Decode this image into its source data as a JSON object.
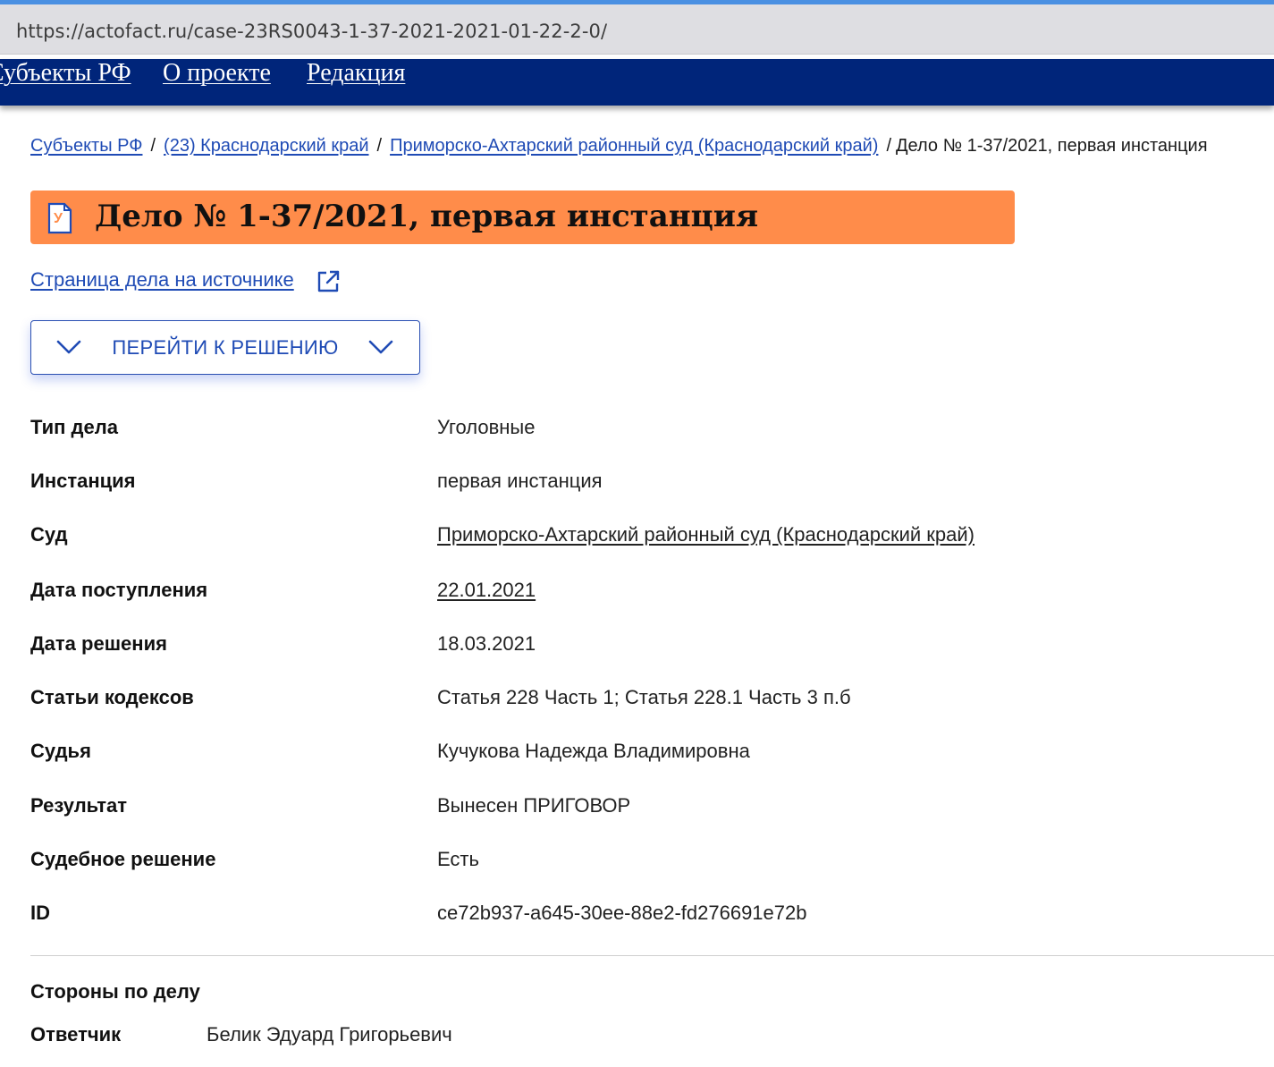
{
  "browser": {
    "url": "https://actofact.ru/case-23RS0043-1-37-2021-2021-01-22-2-0/"
  },
  "nav": {
    "items": [
      {
        "label": "Субъекты РФ"
      },
      {
        "label": "О проекте"
      },
      {
        "label": "Редакция"
      }
    ]
  },
  "breadcrumb": {
    "items": [
      "Субъекты РФ",
      "(23) Краснодарский край",
      "Приморско-Ахтарский районный суд (Краснодарский край)"
    ],
    "separator": "/",
    "current": "Дело № 1-37/2021, первая инстанция"
  },
  "title": {
    "icon_letter": "У",
    "icon": "document-icon",
    "text": "Дело № 1-37/2021, первая инстанция",
    "banner_color": "#ff8c4a"
  },
  "source_link": {
    "label": "Страница дела на источнике",
    "icon": "external-link-icon"
  },
  "goto_button": {
    "label": "ПЕРЕЙТИ К РЕШЕНИЮ",
    "icon": "chevron-down-icon"
  },
  "details": {
    "case_type": {
      "label": "Тип дела",
      "value": "Уголовные"
    },
    "instance": {
      "label": "Инстанция",
      "value": "первая инстанция"
    },
    "court": {
      "label": "Суд",
      "value": "Приморско-Ахтарский районный суд (Краснодарский край)"
    },
    "received_date": {
      "label": "Дата поступления",
      "value": "22.01.2021"
    },
    "decision_date": {
      "label": "Дата решения",
      "value": "18.03.2021"
    },
    "articles": {
      "label": "Статьи кодексов",
      "value": "Статья 228 Часть 1; Статья 228.1 Часть 3 п.б"
    },
    "judge": {
      "label": "Судья",
      "value": "Кучукова Надежда Владимировна"
    },
    "result": {
      "label": "Результат",
      "value": "Вынесен ПРИГОВОР"
    },
    "court_decision": {
      "label": "Судебное решение",
      "value": "Есть"
    },
    "id": {
      "label": "ID",
      "value": "ce72b937-a645-30ee-88e2-fd276691e72b"
    }
  },
  "parties": {
    "title": "Стороны по делу",
    "items": [
      {
        "role": "Ответчик",
        "name": "Белик Эдуард Григорьевич"
      }
    ]
  },
  "colors": {
    "nav_bg": "#00257a",
    "link": "#1f4bb5",
    "accent": "#ff8c4a"
  }
}
